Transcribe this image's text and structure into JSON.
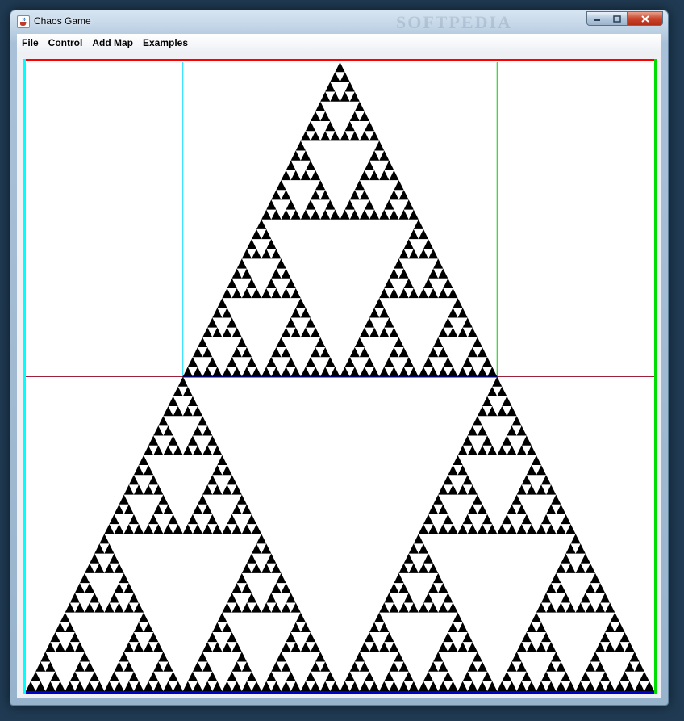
{
  "window": {
    "title": "Chaos Game",
    "watermark": "SOFTPEDIA",
    "app_icon": "java-cup-icon",
    "controls": {
      "minimize": "minimize-icon",
      "maximize": "maximize-icon",
      "close": "close-icon"
    }
  },
  "menu": {
    "items": [
      {
        "label": "File"
      },
      {
        "label": "Control"
      },
      {
        "label": "Add Map"
      },
      {
        "label": "Examples"
      }
    ]
  },
  "canvas": {
    "fractal": "Sierpinski triangle",
    "recursion_depth": 6,
    "colors": {
      "background": "#ffffff",
      "fractal": "#000000",
      "top_border": "#ff0000",
      "bottom_border": "#0000cc",
      "left_border": "#00ffff",
      "right_border": "#00dd00",
      "mid_horizontal_line": "#a0203a",
      "vertical_lines_cyan": "#00d8ff",
      "vertical_line_green": "#00cc00"
    }
  }
}
